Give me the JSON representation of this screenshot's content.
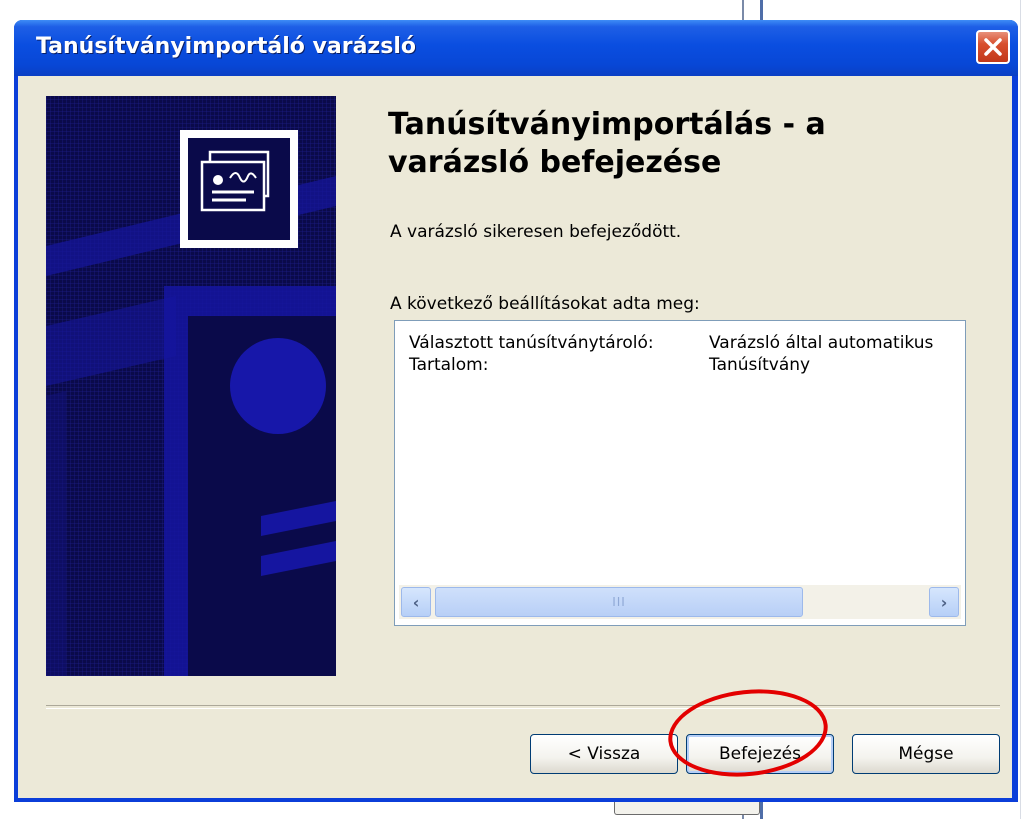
{
  "window": {
    "title": "Tanúsítványimportáló varázsló"
  },
  "heading": "Tanúsítványimportálás - a varázsló befejezése",
  "success_text": "A varázsló sikeresen befejeződött.",
  "settings_label": "A következő beállításokat adta meg:",
  "settings": [
    {
      "key": "Választott tanúsítványtároló:",
      "value": "Varázsló által automatikus"
    },
    {
      "key": "Tartalom:",
      "value": "Tanúsítvány"
    }
  ],
  "scrollbar": {
    "thumb_grip": "III"
  },
  "buttons": {
    "back": "< Vissza",
    "finish": "Befejezés",
    "cancel": "Mégse"
  },
  "colors": {
    "titlebar": "#0a4ee0",
    "banner": "#0a0a4a",
    "highlight_ring": "#e30000"
  }
}
